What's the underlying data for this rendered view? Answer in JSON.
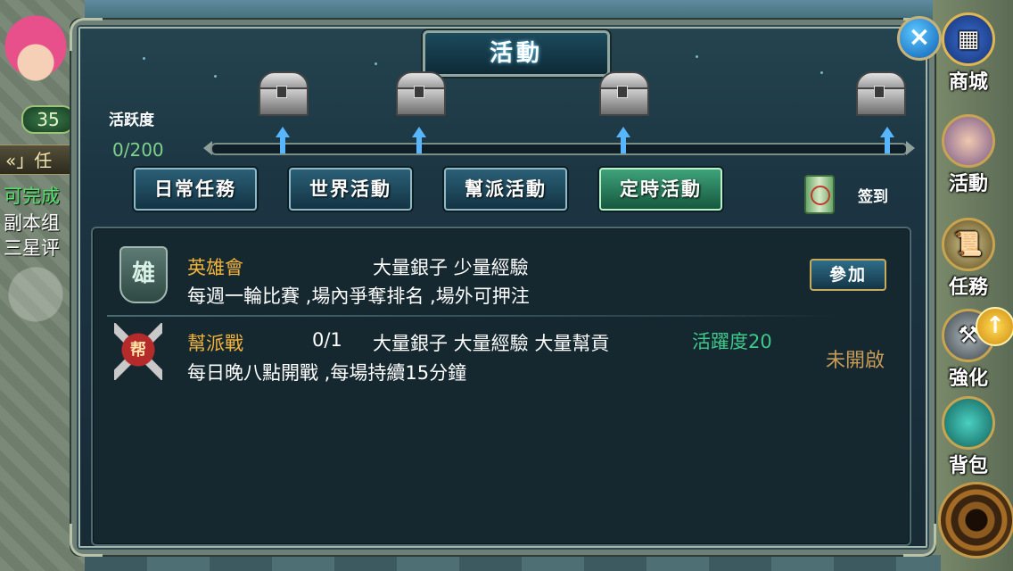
{
  "hud": {
    "level": "35",
    "quest_tab": "«」任",
    "line1": "可完成",
    "line2": "副本组",
    "line3": "三星评"
  },
  "panel": {
    "title": "活動",
    "close_icon": "×",
    "activity": {
      "label": "活跃度",
      "value": "0/200",
      "current": 0,
      "max": 200
    },
    "tabs": [
      {
        "label": "日常任務",
        "active": false
      },
      {
        "label": "世界活動",
        "active": false
      },
      {
        "label": "幫派活動",
        "active": false
      },
      {
        "label": "定時活動",
        "active": true
      }
    ],
    "signin_label": "签到",
    "events": [
      {
        "icon_char": "雄",
        "name": "英雄會",
        "progress": "",
        "rewards": "大量銀子  少量經驗",
        "activity": "",
        "desc": "每週一輪比賽 ,場內爭奪排名 ,場外可押注",
        "action": "參加"
      },
      {
        "icon_char": "帮",
        "name": "幫派戰",
        "progress": "0/1",
        "rewards": "大量銀子  大量經驗  大量幫貢",
        "activity": "活躍度20",
        "desc": "每日晚八點開戰 ,每場持續15分鐘",
        "status": "未開啟"
      }
    ]
  },
  "side_menu": [
    {
      "label": "商城",
      "icon": "shop-icon"
    },
    {
      "label": "活動",
      "icon": "event-icon"
    },
    {
      "label": "任務",
      "icon": "quest-scroll-icon"
    },
    {
      "label": "強化",
      "icon": "hammer-icon"
    },
    {
      "label": "背包",
      "icon": "bag-icon"
    }
  ],
  "upgrade_badge": "↑",
  "colors": {
    "accent_green": "#3fc98a",
    "event_name": "#f2b43a",
    "status": "#c79b58",
    "panel_bg": "#182b36"
  }
}
